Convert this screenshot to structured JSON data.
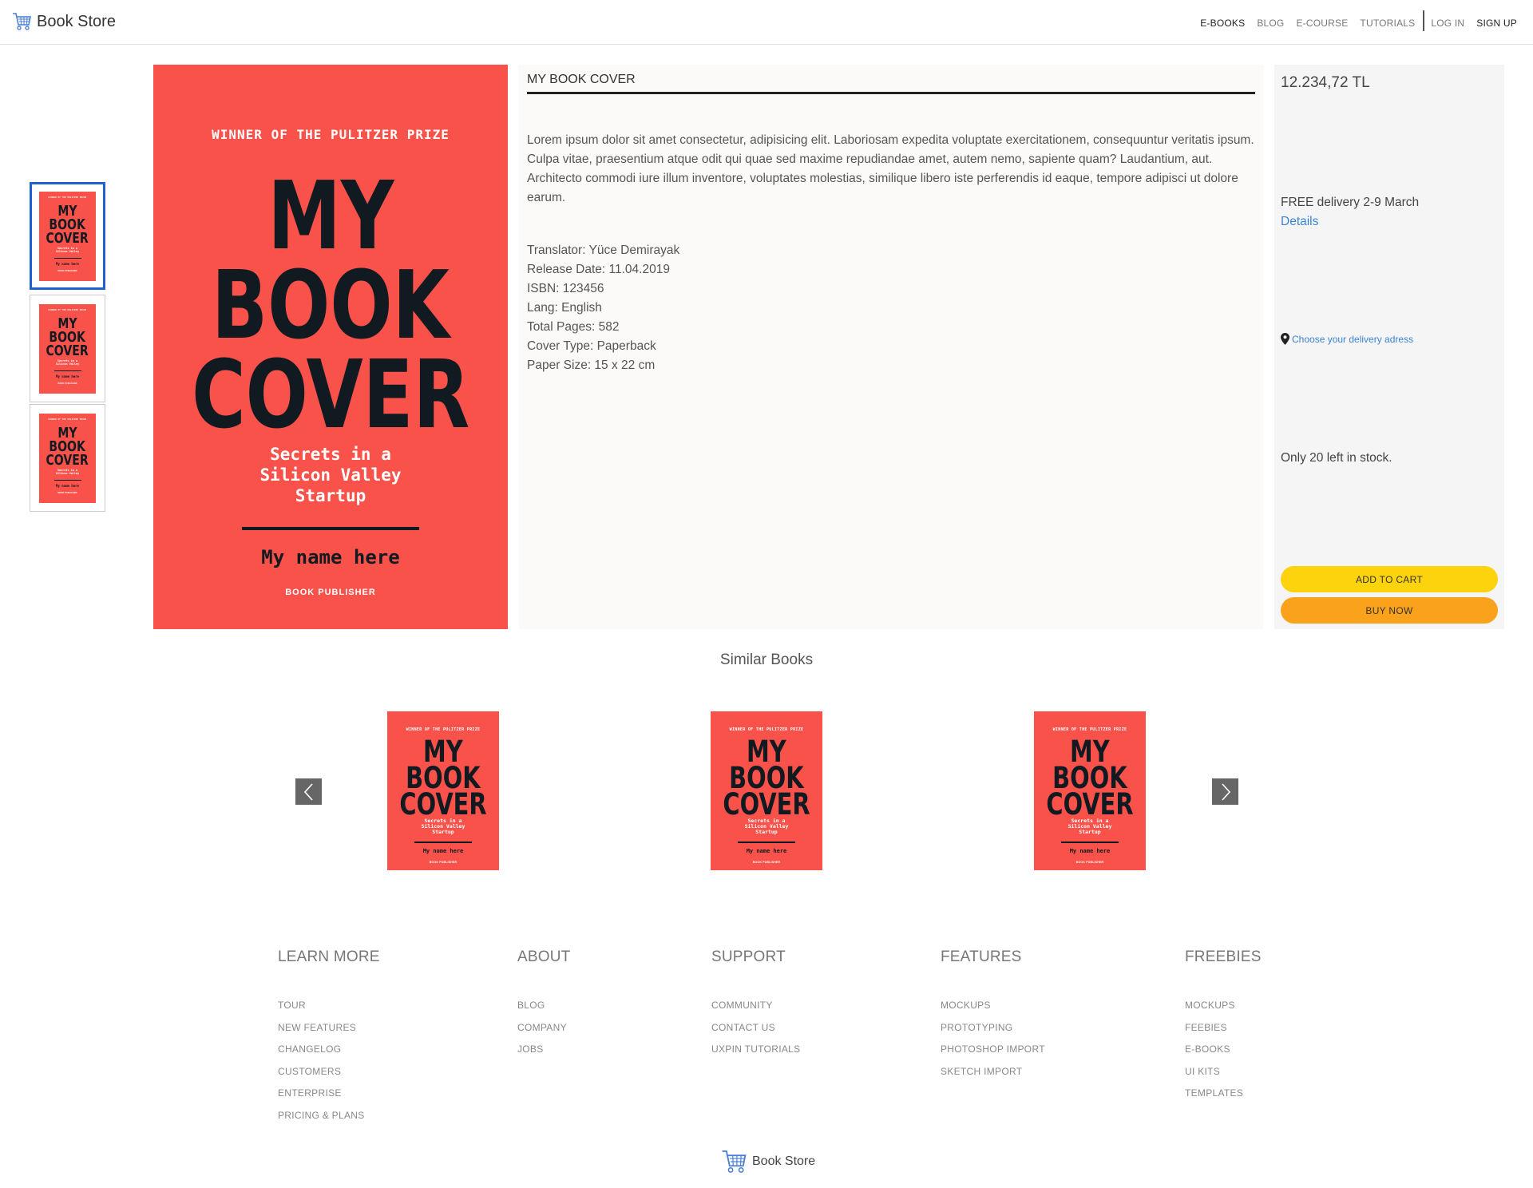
{
  "header": {
    "brand": "Book Store",
    "nav": {
      "ebooks": "E-BOOKS",
      "blog": "BLOG",
      "ecourse": "E-COURSE",
      "tutorials": "TUTORIALS",
      "login": "LOG IN",
      "signup": "SIGN UP"
    }
  },
  "cover": {
    "top": "WINNER OF THE PULITZER PRIZE",
    "title_1": "MY",
    "title_2": "BOOK",
    "title_3": "COVER",
    "subtitle_1": "Secrets in a",
    "subtitle_2": "Silicon Valley",
    "subtitle_3": "Startup",
    "author": "My name here",
    "publisher": "BOOK PUBLISHER"
  },
  "product": {
    "title": "MY BOOK COVER",
    "description": "Lorem ipsum dolor sit amet consectetur, adipisicing elit. Laboriosam expedita voluptate exercitationem, consequuntur veritatis ipsum. Culpa vitae, praesentium atque odit qui quae sed maxime repudiandae amet, autem nemo, sapiente quam? Laudantium, aut. Architecto commodi iure illum inventore, voluptates molestias, similique libero iste perferendis id eaque, tempore adipisci ut dolore earum.",
    "translator": "Translator: Yüce Demirayak",
    "release_date": "Release Date: 11.04.2019",
    "isbn": "ISBN: 123456",
    "lang": "Lang: English",
    "total_pages": "Total Pages: 582",
    "cover_type": "Cover Type: Paperback",
    "paper_size": "Paper Size: 15 x 22 cm"
  },
  "purchase": {
    "price": "12.234,72 TL",
    "delivery": "FREE delivery 2-9 March",
    "details_link": "Details",
    "address_link": "Choose your delivery adress",
    "stock": "Only 20 left in stock.",
    "add_to_cart": "ADD TO CART",
    "buy_now": "BUY NOW"
  },
  "similar": {
    "title": "Similar Books"
  },
  "footer": {
    "columns": [
      {
        "heading": "LEARN MORE",
        "links": [
          "TOUR",
          "NEW FEATURES",
          "CHANGELOG",
          "CUSTOMERS",
          "ENTERPRISE",
          "PRICING & PLANS"
        ]
      },
      {
        "heading": "ABOUT",
        "links": [
          "BLOG",
          "COMPANY",
          "JOBS"
        ]
      },
      {
        "heading": "SUPPORT",
        "links": [
          "COMMUNITY",
          "CONTACT US",
          "UXPIN TUTORIALS"
        ]
      },
      {
        "heading": "FEATURES",
        "links": [
          "MOCKUPS",
          "PROTOTYPING",
          "PHOTOSHOP IMPORT",
          "SKETCH IMPORT"
        ]
      },
      {
        "heading": "FREEBIES",
        "links": [
          "MOCKUPS",
          "FEEBIES",
          "E-BOOKS",
          "UI KITS",
          "TEMPLATES"
        ]
      }
    ],
    "brand": "Book Store"
  },
  "colors": {
    "cover_red": "#f9524a",
    "cover_ink": "#111a20",
    "accent_blue": "#1e62d0",
    "link_blue": "#3b82d6",
    "cart_yellow": "#fdd30e",
    "buy_orange": "#fba21c"
  },
  "icons": {
    "logo": "shopping-cart-icon",
    "location": "map-pin-icon",
    "prev": "chevron-left-icon",
    "next": "chevron-right-icon"
  }
}
